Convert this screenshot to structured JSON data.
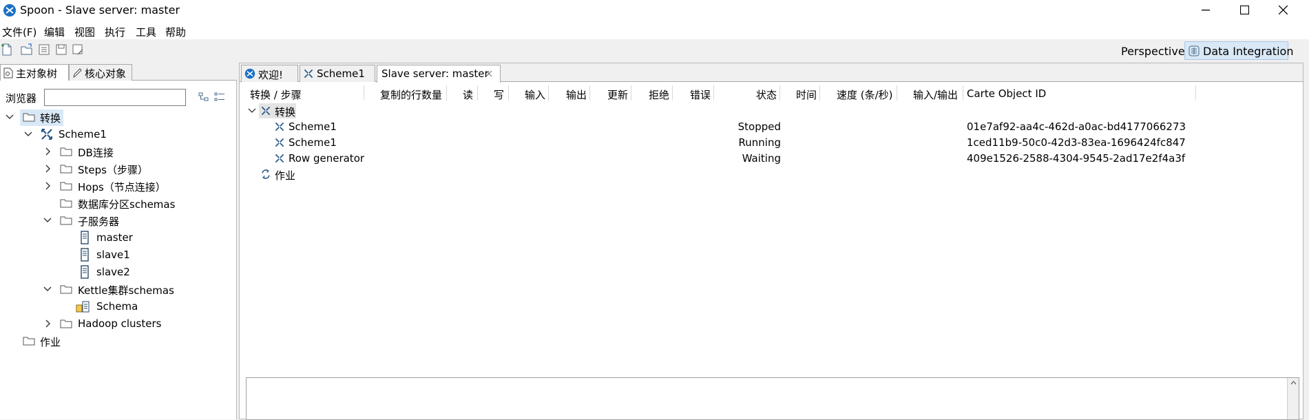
{
  "window": {
    "title": "Spoon - Slave server: master"
  },
  "menu": {
    "items": [
      "文件(F)",
      "编辑",
      "视图",
      "执行",
      "工具",
      "帮助"
    ]
  },
  "toolbar": {
    "icons": [
      "new-file-icon",
      "open-file-icon",
      "explore-icon",
      "save-icon",
      "save-as-icon"
    ],
    "perspective_label": "Perspective:",
    "perspective_value": "Data Integration"
  },
  "left": {
    "tabs": [
      "主对象树",
      "核心对象"
    ],
    "browser_label": "浏览器",
    "search_value": "",
    "tree": [
      {
        "label": "转换",
        "icon": "folder-icon",
        "expanded": true,
        "selected": true
      },
      {
        "label": "Scheme1",
        "icon": "transformation-icon",
        "expanded": true
      },
      {
        "label": "DB连接",
        "icon": "folder-icon",
        "expanded": false
      },
      {
        "label": "Steps（步骤）",
        "icon": "folder-icon",
        "expanded": false
      },
      {
        "label": "Hops（节点连接）",
        "icon": "folder-icon",
        "expanded": false
      },
      {
        "label": "数据库分区schemas",
        "icon": "folder-icon"
      },
      {
        "label": "子服务器",
        "icon": "folder-icon",
        "expanded": true
      },
      {
        "label": "master",
        "icon": "server-icon"
      },
      {
        "label": "slave1",
        "icon": "server-icon"
      },
      {
        "label": "slave2",
        "icon": "server-icon"
      },
      {
        "label": "Kettle集群schemas",
        "icon": "folder-icon",
        "expanded": true
      },
      {
        "label": "Schema",
        "icon": "cluster-schema-icon"
      },
      {
        "label": "Hadoop clusters",
        "icon": "folder-icon",
        "expanded": false
      },
      {
        "label": "作业",
        "icon": "folder-icon"
      }
    ]
  },
  "right": {
    "tabs": [
      {
        "label": "欢迎!",
        "icon": "spoon-icon"
      },
      {
        "label": "Scheme1",
        "icon": "transformation-icon"
      },
      {
        "label": "Slave server: master",
        "icon": "",
        "active": true,
        "closable": true
      }
    ],
    "columns": [
      "转换 / 步骤",
      "复制的行数量",
      "读",
      "写",
      "输入",
      "输出",
      "更新",
      "拒绝",
      "错误",
      "状态",
      "时间",
      "速度 (条/秒)",
      "输入/输出",
      "Carte Object ID"
    ],
    "group_transform": "转换",
    "rows": [
      {
        "name": "Scheme1",
        "status": "Stopped",
        "id": "01e7af92-aa4c-462d-a0ac-bd4177066273"
      },
      {
        "name": "Scheme1",
        "status": "Running",
        "id": "1ced11b9-50c0-42d3-83ea-1696424fc847"
      },
      {
        "name": "Row generator",
        "status": "Waiting",
        "id": "409e1526-2588-4304-9545-2ad17e2f4a3f"
      }
    ],
    "group_job": "作业"
  },
  "colors": {
    "selection": "#d9e8f6",
    "accent": "#1a6fc4"
  }
}
